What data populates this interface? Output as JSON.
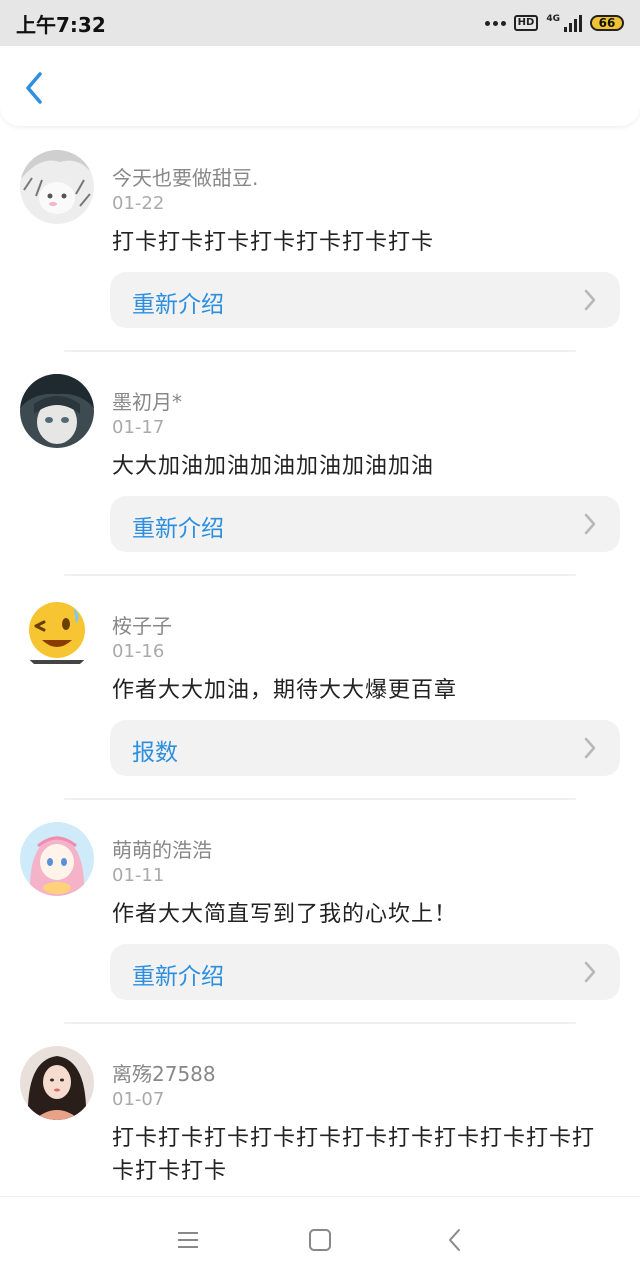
{
  "status_bar": {
    "time": "上午7:32",
    "hd_badge": "HD",
    "network": "4G",
    "battery": "66"
  },
  "header": {
    "back_icon": "chevron-left-icon",
    "accent_color": "#2c8fe0"
  },
  "comments": [
    {
      "name": "今天也要做甜豆.",
      "date": "01-22",
      "text": "打卡打卡打卡打卡打卡打卡打卡",
      "action": "重新介绍"
    },
    {
      "name": "墨初月*",
      "date": "01-17",
      "text": "大大加油加油加油加油加油加油",
      "action": "重新介绍"
    },
    {
      "name": "桉子子",
      "date": "01-16",
      "text": "作者大大加油，期待大大爆更百章",
      "action": "报数"
    },
    {
      "name": "萌萌的浩浩",
      "date": "01-11",
      "text": "作者大大简直写到了我的心坎上！",
      "action": "重新介绍"
    },
    {
      "name": "离殇27588",
      "date": "01-07",
      "text": "打卡打卡打卡打卡打卡打卡打卡打卡打卡打卡打卡打卡打卡"
    }
  ],
  "nav_bar": {
    "menu_icon": "menu-icon",
    "home_icon": "square-home-icon",
    "back_icon": "back-triangle-icon"
  }
}
